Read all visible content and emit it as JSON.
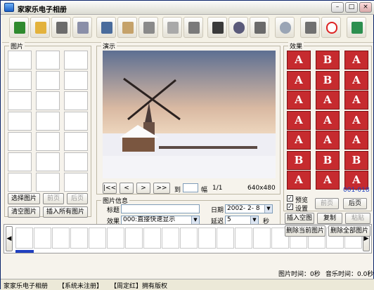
{
  "app": {
    "title": "家家乐电子相册"
  },
  "window_buttons": {
    "min": "–",
    "max": "□",
    "close": "×"
  },
  "toolbar": {
    "icons": [
      "open-folder-icon",
      "folder-icon",
      "save-icon",
      "window-icon",
      "image-icon",
      "image-folder-icon",
      "delete-image-icon",
      "settings-icon",
      "list-icon",
      "film-icon",
      "music-icon",
      "clip-icon",
      "zoom-icon",
      "camera-icon",
      "no-icon",
      "exit-icon"
    ]
  },
  "panels": {
    "pictures": "图片",
    "preview": "演示",
    "effects": "效果",
    "picinfo": "图片信息"
  },
  "left": {
    "select": "选择图片",
    "prev": "前页",
    "next": "后页",
    "clear": "清空图片",
    "insert_all": "插入所有图片"
  },
  "nav": {
    "first": "|<<",
    "prev": "<",
    "next": ">",
    "last": ">>",
    "goto": "到",
    "unit": "幅",
    "page": "1/1",
    "size": "640x480"
  },
  "info": {
    "title_label": "标题",
    "date_label": "日期",
    "date_value": "2002- 2- 8",
    "effect_label": "效果",
    "effect_value": "000:直接快速显示",
    "delay_label": "延迟",
    "delay_value": "5",
    "sec": "秒",
    "desc_label": "说明"
  },
  "effects_panel": {
    "letters": [
      [
        "A",
        "B",
        "A"
      ],
      [
        "A",
        "B",
        "A"
      ],
      [
        "A",
        "A",
        "A"
      ],
      [
        "A",
        "A",
        "A"
      ],
      [
        "A",
        "A",
        "A"
      ],
      [
        "B",
        "B",
        "B"
      ],
      [
        "A",
        "A",
        "A"
      ]
    ],
    "range": "001-018",
    "preview_label": "预览",
    "settings_label": "设置",
    "prev": "前页",
    "next": "后页"
  },
  "actions": {
    "insert_blank": "插入空图",
    "copy": "复制",
    "paste": "粘贴",
    "delete_current": "删除当前图片",
    "delete_all": "删除全部图片"
  },
  "timeline": {
    "pic_time": "图片时间：0秒",
    "music_time": "音乐时间：0.0秒"
  },
  "statusbar": {
    "app": "家家乐电子相册",
    "reg": "【系统未注册】",
    "copyright": "【周定红】拥有版权"
  },
  "colors": {
    "titlebar": "#dcdcd2",
    "effect_red": "#c62b2f",
    "accent_blue": "#2040c0"
  }
}
